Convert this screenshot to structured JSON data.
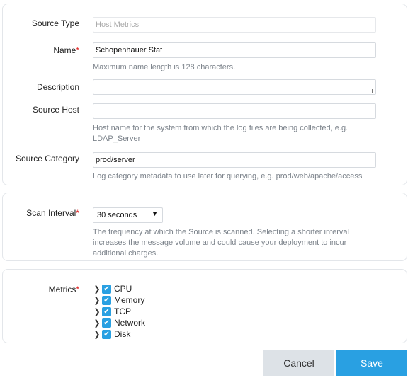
{
  "source_type": {
    "label": "Source Type",
    "value": "Host Metrics"
  },
  "name": {
    "label": "Name",
    "required": "*",
    "value": "Schopenhauer Stat",
    "help": "Maximum name length is 128 characters."
  },
  "description": {
    "label": "Description",
    "value": ""
  },
  "source_host": {
    "label": "Source Host",
    "value": "",
    "help": "Host name for the system from which the log files are being collected, e.g. LDAP_Server"
  },
  "source_category": {
    "label": "Source Category",
    "value": "prod/server",
    "help": "Log category metadata to use later for querying, e.g. prod/web/apache/access"
  },
  "scan_interval": {
    "label": "Scan Interval",
    "required": "*",
    "value": "30 seconds",
    "arrow": "▼",
    "help": "The frequency at which the Source is scanned. Selecting a shorter interval increases the message volume and could cause your deployment to incur additional charges."
  },
  "metrics": {
    "label": "Metrics",
    "required": "*",
    "items": [
      {
        "label": "CPU",
        "checked": true
      },
      {
        "label": "Memory",
        "checked": true
      },
      {
        "label": "TCP",
        "checked": true
      },
      {
        "label": "Network",
        "checked": true
      },
      {
        "label": "Disk",
        "checked": true
      }
    ]
  },
  "buttons": {
    "cancel": "Cancel",
    "save": "Save"
  },
  "colors": {
    "accent": "#29a0e2",
    "cancel_bg": "#dde2e7",
    "required": "#e02020"
  }
}
